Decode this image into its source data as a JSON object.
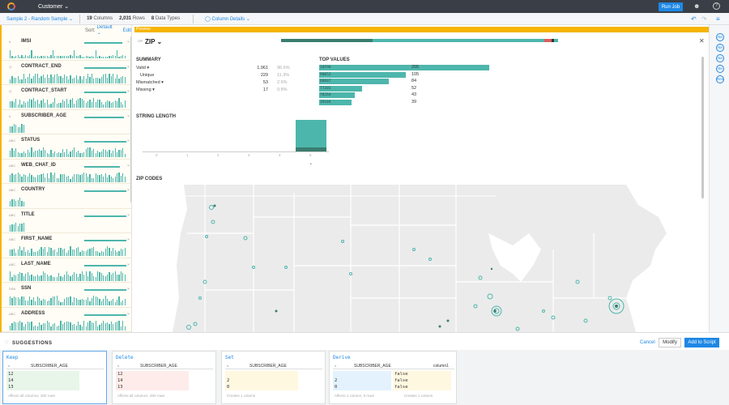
{
  "topbar": {
    "title": "Customer ⌄",
    "run_job": "Run Job",
    "help": "?"
  },
  "toolbar": {
    "sample": "Sample 2 - Random Sample ⌄",
    "columns_n": "19",
    "columns_label": "Columns",
    "rows_n": "2,031",
    "rows_label": "Rows",
    "types_n": "8",
    "types_label": "Data Types",
    "column_details": "Column Details ⌄"
  },
  "left_panel": {
    "sort_label": "Sort:",
    "sort_value": "Default ⌄",
    "edit": "Edit",
    "columns": [
      {
        "type": "#",
        "name": "IMSI",
        "bar": 0.9
      },
      {
        "type": "◷",
        "name": "CONTRACT_END",
        "bar": 1.0
      },
      {
        "type": "◷",
        "name": "CONTRACT_START",
        "bar": 1.0
      },
      {
        "type": "#",
        "name": "SUBSCRIBER_AGE",
        "bar": 0.95
      },
      {
        "type": "ABC",
        "name": "STATUS",
        "bar": 1.0
      },
      {
        "type": "ABC",
        "name": "WEB_CHAT_ID",
        "bar": 0.85
      },
      {
        "type": "ABC",
        "name": "COUNTRY",
        "bar": 1.0
      },
      {
        "type": "ABC",
        "name": "TITLE",
        "bar": 1.0
      },
      {
        "type": "ABC",
        "name": "FIRST_NAME",
        "bar": 1.0
      },
      {
        "type": "ABC",
        "name": "LAST_NAME",
        "bar": 1.0
      },
      {
        "type": "SSN",
        "name": "SSN",
        "bar": 1.0
      },
      {
        "type": "ABC",
        "name": "ADDRESS",
        "bar": 1.0
      }
    ]
  },
  "preview": "Preview",
  "detail": {
    "type": "ZIP",
    "title": "ZIP ⌄",
    "quality": {
      "valid": 0.33,
      "other": 0.62,
      "mismatched": 0.026,
      "missing": 0.01
    },
    "summary_title": "SUMMARY",
    "summary": [
      {
        "label": "Valid ▾",
        "count": "1,961",
        "pct": "96.6%"
      },
      {
        "label": "Unique",
        "count": "229",
        "pct": "11.3%"
      },
      {
        "label": "Mismatched ▾",
        "count": "53",
        "pct": "2.6%"
      },
      {
        "label": "Missing ▾",
        "count": "17",
        "pct": "0.8%"
      }
    ],
    "top_values_title": "TOP VALUES",
    "top_values": [
      {
        "zip": "10590",
        "count": "205",
        "frac": 1.0
      },
      {
        "zip": "98052",
        "count": "105",
        "frac": 0.51
      },
      {
        "zip": "60607",
        "count": "84",
        "frac": 0.41
      },
      {
        "zip": "77201",
        "count": "52",
        "frac": 0.25
      },
      {
        "zip": "78264",
        "count": "43",
        "frac": 0.21
      },
      {
        "zip": "39104",
        "count": "39",
        "frac": 0.19
      }
    ],
    "string_length_title": "STRING LENGTH",
    "string_length_ticks": [
      "0",
      "1",
      "2",
      "3",
      "4",
      "5"
    ],
    "string_length_dot": "•",
    "zip_codes_title": "ZIP CODES"
  },
  "suggestions": {
    "title": "SUGGESTIONS",
    "cancel": "Cancel",
    "modify": "Modify",
    "add": "Add to Script",
    "cards": [
      {
        "title": "Keep",
        "header": "SUBSCRIBER_AGE",
        "type": "#",
        "rows": [
          "12",
          "14",
          "13"
        ],
        "foot": "Affects all columns, 280 rows"
      },
      {
        "title": "Delete",
        "header": "SUBSCRIBER_AGE",
        "type": "#",
        "rows": [
          "12",
          "14",
          "13"
        ],
        "foot": "Affects all columns, 280 rows"
      },
      {
        "title": "Set",
        "header": "SUBSCRIBER_AGE",
        "type": "#",
        "rows": [
          "",
          "2",
          "0"
        ],
        "foot": "Creates 1 column"
      },
      {
        "title": "Derive",
        "header": "SUBSCRIBER_AGE",
        "type": "#",
        "header2": "column1",
        "rows": [
          "",
          "2",
          "0"
        ],
        "rows2": [
          "false",
          "false",
          "false"
        ],
        "foot": "Affects 1 column, 0 rows",
        "foot2": "Creates 1 column"
      }
    ]
  },
  "rail": [
    "Ne",
    "Ne",
    "Ne",
    "Ne",
    "Res"
  ]
}
